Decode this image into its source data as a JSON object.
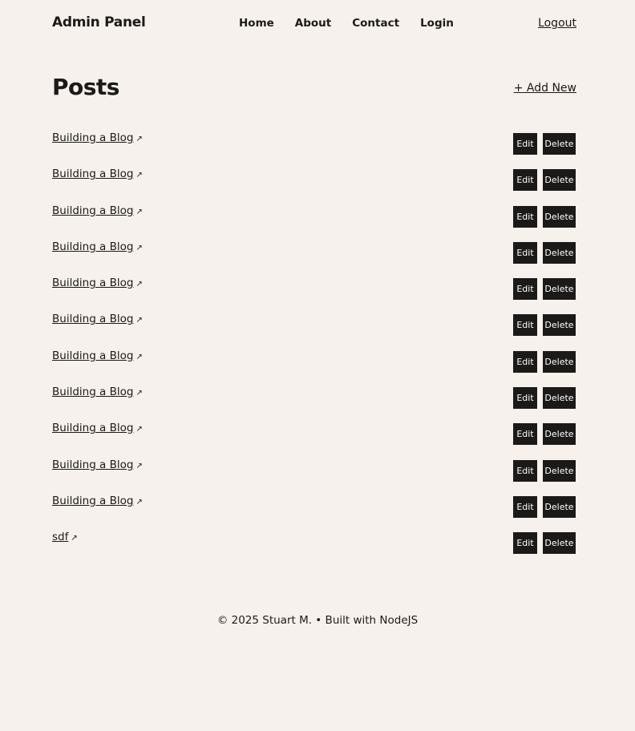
{
  "header": {
    "logo": "Admin Panel",
    "nav": [
      "Home",
      "About",
      "Contact",
      "Login"
    ],
    "logout": "Logout"
  },
  "page": {
    "title": "Posts",
    "add_new": "+ Add New"
  },
  "posts": [
    "Building a Blog",
    "Building a Blog",
    "Building a Blog",
    "Building a Blog",
    "Building a Blog",
    "Building a Blog",
    "Building a Blog",
    "Building a Blog",
    "Building a Blog",
    "Building a Blog",
    "Building a Blog",
    "sdf"
  ],
  "actions": {
    "edit": "Edit",
    "delete": "Delete",
    "external_icon": "↗"
  },
  "footer": {
    "text": "© 2025 Stuart M. • Built with NodeJS"
  }
}
